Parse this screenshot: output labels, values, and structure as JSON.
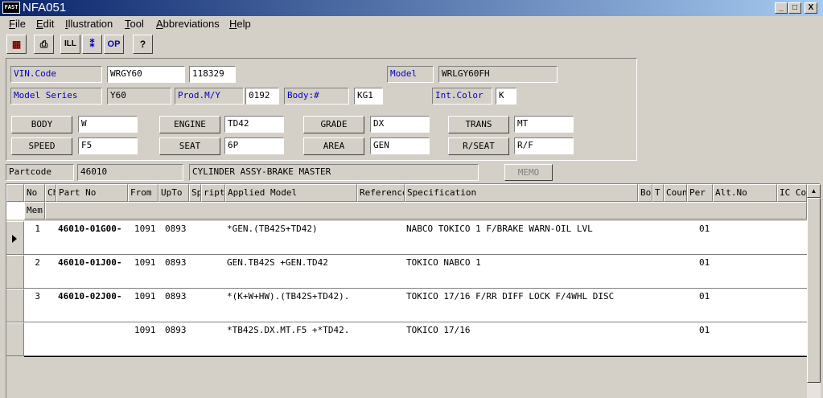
{
  "window": {
    "title": "NFA051",
    "icon_text": "FAST",
    "minimize": "_",
    "maximize": "□",
    "close": "X"
  },
  "menu": [
    "File",
    "Edit",
    "Illustration",
    "Tool",
    "Abbreviations",
    "Help"
  ],
  "menu_underline": [
    "F",
    "E",
    "I",
    "T",
    "A",
    "H"
  ],
  "toolbar": {
    "buttons": [
      {
        "icon": "catalog-icon",
        "glyph": "▦"
      },
      {
        "icon": "print-icon",
        "glyph": "⎙"
      },
      {
        "icon": "illustration-icon",
        "glyph": "ILL"
      },
      {
        "icon": "tree-icon",
        "glyph": "⁑"
      },
      {
        "icon": "option-icon",
        "glyph": "OP"
      },
      {
        "icon": "help-icon",
        "glyph": "?"
      }
    ]
  },
  "vehicle": {
    "vin_label": "VIN.Code",
    "vin_value": "WRGY60",
    "vin_serial": "118329",
    "model_label": "Model",
    "model_value": "WRLGY60FH",
    "series_label": "Model Series",
    "series_value": "Y60",
    "prod_label": "Prod.M/Y",
    "prod_value": "0192",
    "body_no_label": "Body:#",
    "body_no_value": "KG1",
    "color_label": "Int.Color",
    "color_value": "K"
  },
  "specs": [
    {
      "label": "BODY",
      "value": "W"
    },
    {
      "label": "ENGINE",
      "value": "TD42"
    },
    {
      "label": "GRADE",
      "value": "DX"
    },
    {
      "label": "TRANS",
      "value": "MT"
    },
    {
      "label": "SPEED",
      "value": "F5"
    },
    {
      "label": "SEAT",
      "value": "6P"
    },
    {
      "label": "AREA",
      "value": "GEN"
    },
    {
      "label": "R/SEAT",
      "value": "R/F"
    }
  ],
  "part": {
    "label": "Partcode",
    "code": "46010",
    "name": "CYLINDER ASSY-BRAKE MASTER",
    "memo_button": "MEMO"
  },
  "grid": {
    "headers": [
      "No",
      "Ch",
      "Part No",
      "From",
      "UpTo",
      "Sp",
      "ript",
      "Applied Model",
      "Reference",
      "Specification",
      "Bo",
      "T",
      "Coun",
      "Per",
      "Alt.No",
      "IC Co"
    ],
    "subheader": "Mem",
    "rows": [
      {
        "no": "1",
        "part_no": "46010-01G00-",
        "from": "1091",
        "upto": "0893",
        "applied": "*GEN.(TB42S+TD42)",
        "spec": "NABCO TOKICO 1 F/BRAKE WARN-OIL LVL",
        "per": "01"
      },
      {
        "no": "2",
        "part_no": "46010-01J00-",
        "from": "1091",
        "upto": "0893",
        "applied": "GEN.TB42S +GEN.TD42",
        "spec": "TOKICO NABCO 1",
        "per": "01"
      },
      {
        "no": "3",
        "part_no": "46010-02J00-",
        "from": "1091",
        "upto": "0893",
        "applied": "*(K+W+HW).(TB42S+TD42).",
        "spec": "TOKICO 17/16 F/RR DIFF LOCK F/4WHL DISC",
        "per": "01"
      },
      {
        "no": "",
        "part_no": "",
        "from": "1091",
        "upto": "0893",
        "applied": "*TB42S.DX.MT.F5 +*TD42.",
        "spec": "TOKICO 17/16",
        "per": "01"
      }
    ]
  }
}
